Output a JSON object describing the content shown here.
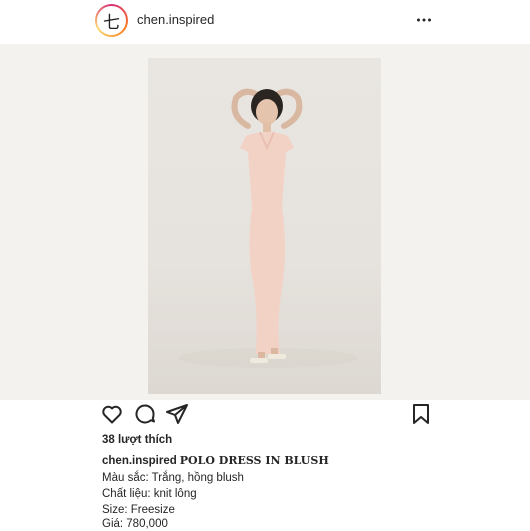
{
  "header": {
    "username": "chen.inspired",
    "avatar_glyph": "七",
    "more_icon": "more-horizontal-icon"
  },
  "post": {
    "image_alt": "Model wearing pink polo dress"
  },
  "actions": {
    "icons": [
      "heart-icon",
      "comment-icon",
      "share-icon",
      "bookmark-icon"
    ]
  },
  "likes_text": "38 lượt thích",
  "caption": {
    "username": "chen.inspired",
    "title": "POLO DRESS IN BLUSH",
    "lines": [
      "Màu sắc: Trắng, hồng blush",
      "Chất liệu: knit lông",
      "Size: Freesize",
      "Giá: 780,000"
    ]
  },
  "colors": {
    "accent_ring": "#d62976",
    "dress": "#f3d2c6",
    "background": "#f4f2ef"
  }
}
